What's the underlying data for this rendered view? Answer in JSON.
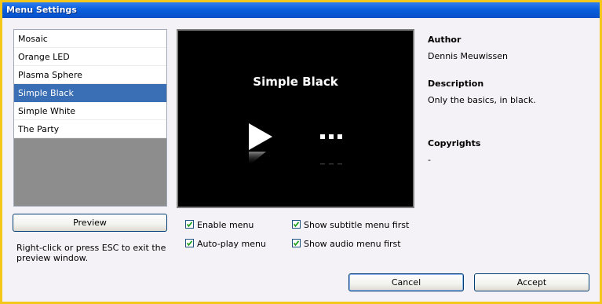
{
  "window": {
    "title": "Menu Settings"
  },
  "menu_list": {
    "items": [
      "Mosaic",
      "Orange LED",
      "Plasma Sphere",
      "Simple Black",
      "Simple White",
      "The Party"
    ],
    "selected": "Simple Black"
  },
  "preview_pane": {
    "title": "Simple Black"
  },
  "details": {
    "author_heading": "Author",
    "author": "Dennis Meuwissen",
    "description_heading": "Description",
    "description": "Only the basics, in black.",
    "copyrights_heading": "Copyrights",
    "copyrights": "-"
  },
  "preview_button": {
    "label": "Preview"
  },
  "hint": {
    "text": "Right-click or press ESC to exit the preview window."
  },
  "options": {
    "enable_menu": {
      "label": "Enable menu",
      "checked": true
    },
    "auto_play_menu": {
      "label": "Auto-play menu",
      "checked": true
    },
    "show_subtitle_menu_first": {
      "label": "Show subtitle menu first",
      "checked": true
    },
    "show_audio_menu_first": {
      "label": "Show audio menu first",
      "checked": true
    }
  },
  "buttons": {
    "cancel": "Cancel",
    "accept": "Accept"
  },
  "colors": {
    "titlebar": "#0a5fdd",
    "selection": "#3a6eb5",
    "frame": "#f4c81a",
    "check": "#21a121"
  }
}
